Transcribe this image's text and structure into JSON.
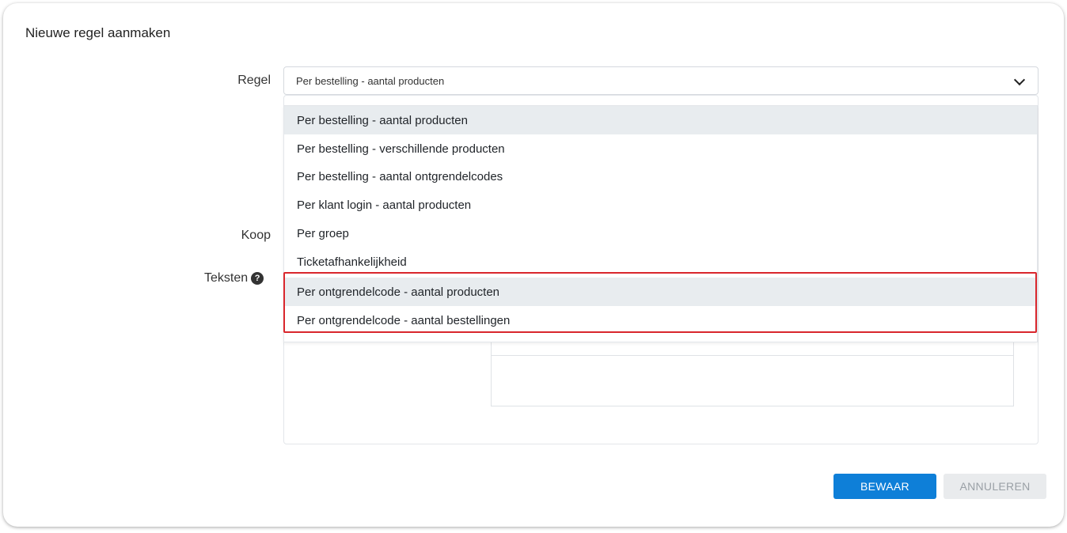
{
  "dialog": {
    "title": "Nieuwe regel aanmaken"
  },
  "form": {
    "regel_label": "Regel",
    "koop_label": "Koop",
    "teksten_label": "Teksten",
    "regel_selected": "Per bestelling - aantal producten"
  },
  "dropdown": {
    "options": [
      "Per bestelling - aantal producten",
      "Per bestelling - verschillende producten",
      "Per bestelling - aantal ontgrendelcodes",
      "Per klant login - aantal producten",
      "Per groep",
      "Ticketafhankelijkheid",
      "Per ontgrendelcode - aantal producten",
      "Per ontgrendelcode - aantal bestellingen"
    ]
  },
  "buttons": {
    "save": "BEWAAR",
    "cancel": "ANNULEREN"
  },
  "icons": {
    "help": "help-icon",
    "chevron": "chevron-down-icon"
  },
  "colors": {
    "primary": "#0e7fd8",
    "highlight": "#d9262c"
  }
}
